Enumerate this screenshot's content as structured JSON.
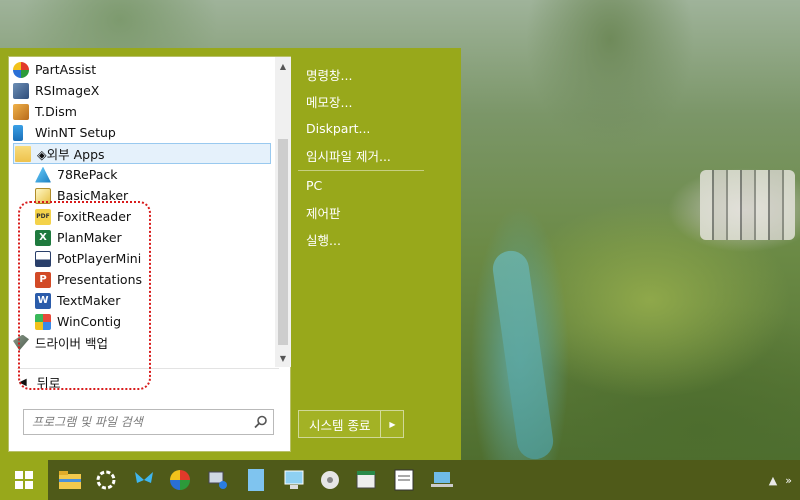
{
  "colors": {
    "menu_bg": "#98a81b",
    "taskbar_bg": "#4f5a19",
    "highlight_border": "#d81b1b",
    "folder_selection": "#e5f1fb"
  },
  "app_list": {
    "items": [
      {
        "label": "PartAssist",
        "icon": "partassist-icon"
      },
      {
        "label": "RSImageX",
        "icon": "rsimagex-icon"
      },
      {
        "label": "T.Dism",
        "icon": "tdism-icon"
      },
      {
        "label": "WinNT Setup",
        "icon": "winnt-setup-icon"
      },
      {
        "label": "◈외부 Apps",
        "icon": "folder-icon"
      },
      {
        "label": "78RePack",
        "icon": "78repack-icon"
      },
      {
        "label": "BasicMaker",
        "icon": "basicmaker-icon"
      },
      {
        "label": "FoxitReader",
        "icon": "pdf-icon"
      },
      {
        "label": "PlanMaker",
        "icon": "planmaker-icon"
      },
      {
        "label": "PotPlayerMini",
        "icon": "potplayer-icon"
      },
      {
        "label": "Presentations",
        "icon": "presentations-icon"
      },
      {
        "label": "TextMaker",
        "icon": "textmaker-icon"
      },
      {
        "label": "WinContig",
        "icon": "wincontig-icon"
      },
      {
        "label": "드라이버 백업",
        "icon": "driver-backup-icon"
      }
    ]
  },
  "back": {
    "label": "뒤로"
  },
  "search": {
    "placeholder": "프로그램 및 파일 검색"
  },
  "right_menu": {
    "items": [
      "명령창...",
      "메모장...",
      "Diskpart...",
      "임시파일 제거...",
      "PC",
      "제어판",
      "실행..."
    ]
  },
  "shutdown": {
    "label": "시스템 종료"
  },
  "taskbar": {
    "icons": [
      "windows-start-icon",
      "file-explorer-icon",
      "settings-icon",
      "butterfly-app-icon",
      "partassist-icon",
      "network-icon",
      "document-icon",
      "computer-icon",
      "disc-icon",
      "archive-icon",
      "notepad-icon",
      "tools-icon",
      "laptop-icon"
    ]
  }
}
